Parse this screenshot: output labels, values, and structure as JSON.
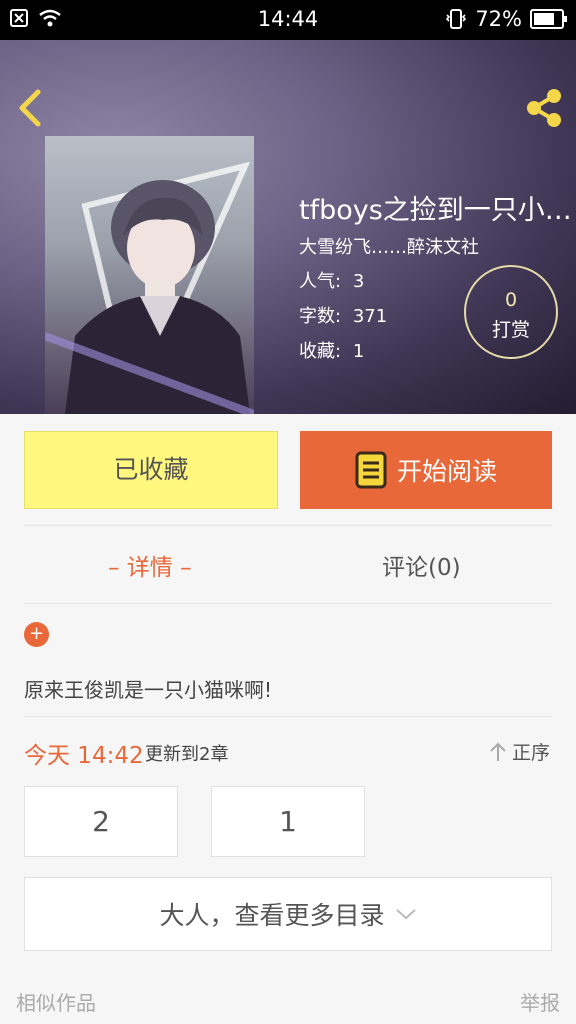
{
  "status_bar": {
    "time": "14:44",
    "battery": "72%"
  },
  "book": {
    "title": "tfboys之捡到一只小…",
    "author": "大雪纷飞……醉沫文社",
    "stats": [
      {
        "label": "人气:",
        "value": "3"
      },
      {
        "label": "字数:",
        "value": "371"
      },
      {
        "label": "收藏:",
        "value": "1"
      }
    ],
    "reward": {
      "count": "0",
      "label": "打赏"
    }
  },
  "actions": {
    "favorite": "已收藏",
    "read": "开始阅读"
  },
  "tabs": {
    "detail": "– 详情 –",
    "comments": "评论(0)"
  },
  "detail": {
    "expand": "+",
    "description": "原来王俊凯是一只小猫咪啊!"
  },
  "update": {
    "time": "今天 14:42",
    "text": "更新到2章",
    "order": "正序"
  },
  "chapters": [
    "2",
    "1"
  ],
  "more_catalog": "大人，查看更多目录",
  "footer": {
    "similar": "相似作品",
    "report": "举报"
  },
  "colors": {
    "accent": "#e8683a",
    "favorite_bg": "#fff77e",
    "icon_yellow": "#f5d73c"
  }
}
